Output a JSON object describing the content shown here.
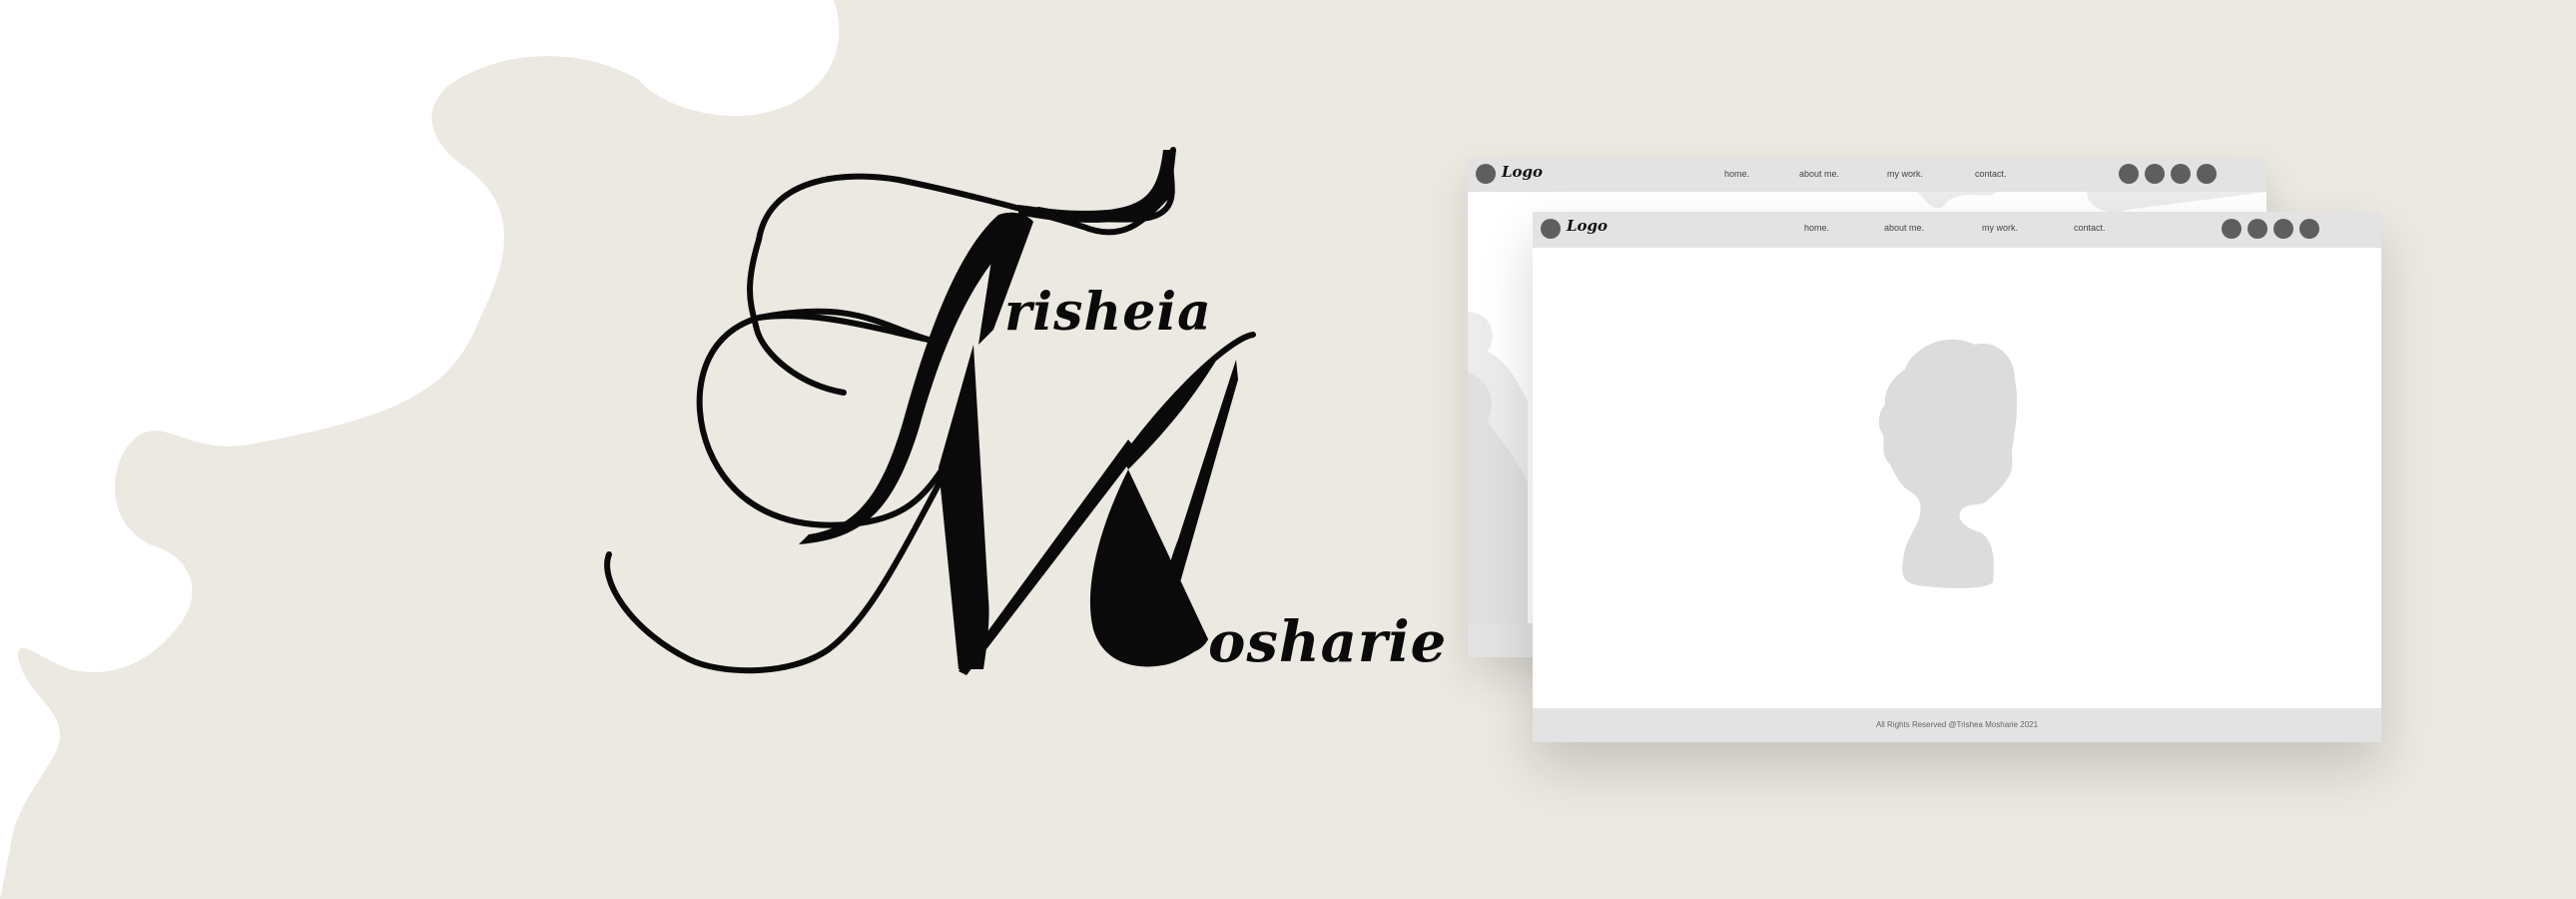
{
  "brand": {
    "first_name": "Trisheia",
    "first_name_rest": "risheia",
    "last_name": "Mosharie",
    "last_name_rest": "osharie"
  },
  "mockup": {
    "logo_label": "Logo",
    "nav": [
      "home.",
      "about me.",
      "my work.",
      "contact."
    ],
    "footer_text": "All Rights Reserved @Trishea Mosharie 2021"
  },
  "colors": {
    "background": "#ebe9e1",
    "blob": "#ffffff",
    "ink": "#0a0a0a",
    "bar": "#e3e3e3",
    "dot": "#5e5e5e",
    "silhouette": "#dcdcdc"
  }
}
